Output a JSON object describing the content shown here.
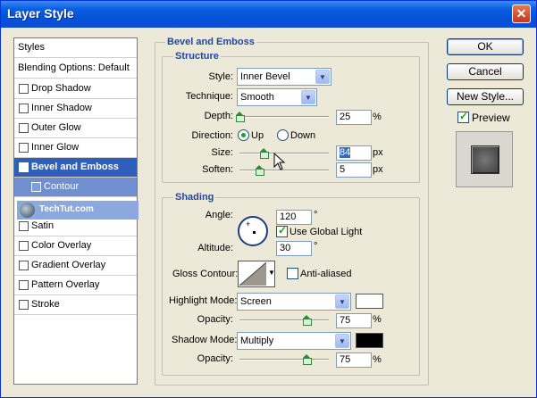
{
  "window": {
    "title": "Layer Style",
    "close_glyph": "✕"
  },
  "styles_list": {
    "header": "Styles",
    "blending": "Blending Options: Default",
    "items": [
      {
        "label": "Drop Shadow",
        "checked": false
      },
      {
        "label": "Inner Shadow",
        "checked": false
      },
      {
        "label": "Outer Glow",
        "checked": false
      },
      {
        "label": "Inner Glow",
        "checked": false
      },
      {
        "label": "Bevel and Emboss",
        "checked": true
      },
      {
        "label": "Contour",
        "checked": false
      },
      {
        "label": "Satin",
        "checked": false
      },
      {
        "label": "Color Overlay",
        "checked": false
      },
      {
        "label": "Gradient Overlay",
        "checked": false
      },
      {
        "label": "Pattern Overlay",
        "checked": false
      },
      {
        "label": "Stroke",
        "checked": false
      }
    ]
  },
  "watermark": {
    "text": "TechTut.com"
  },
  "bevel": {
    "title": "Bevel and Emboss",
    "structure": {
      "title": "Structure",
      "style_label": "Style:",
      "style_value": "Inner Bevel",
      "technique_label": "Technique:",
      "technique_value": "Smooth",
      "depth_label": "Depth:",
      "depth_value": "25",
      "depth_unit": "%",
      "direction_label": "Direction:",
      "direction_up": "Up",
      "direction_down": "Down",
      "size_label": "Size:",
      "size_value": "84",
      "size_unit": "px",
      "soften_label": "Soften:",
      "soften_value": "5",
      "soften_unit": "px"
    },
    "shading": {
      "title": "Shading",
      "angle_label": "Angle:",
      "angle_value": "120",
      "angle_unit": "°",
      "global_light_label": "Use Global Light",
      "altitude_label": "Altitude:",
      "altitude_value": "30",
      "altitude_unit": "°",
      "gloss_label": "Gloss Contour:",
      "anti_aliased_label": "Anti-aliased",
      "highlight_mode_label": "Highlight Mode:",
      "highlight_mode_value": "Screen",
      "highlight_color": "#ffffff",
      "highlight_opacity_label": "Opacity:",
      "highlight_opacity_value": "75",
      "highlight_opacity_unit": "%",
      "shadow_mode_label": "Shadow Mode:",
      "shadow_mode_value": "Multiply",
      "shadow_color": "#000000",
      "shadow_opacity_label": "Opacity:",
      "shadow_opacity_value": "75",
      "shadow_opacity_unit": "%"
    }
  },
  "buttons": {
    "ok": "OK",
    "cancel": "Cancel",
    "new_style": "New Style...",
    "preview_label": "Preview"
  },
  "levels": {
    "depth": 0.0,
    "size": 0.27,
    "soften": 0.22,
    "highlight_opacity": 0.75,
    "shadow_opacity": 0.75
  }
}
